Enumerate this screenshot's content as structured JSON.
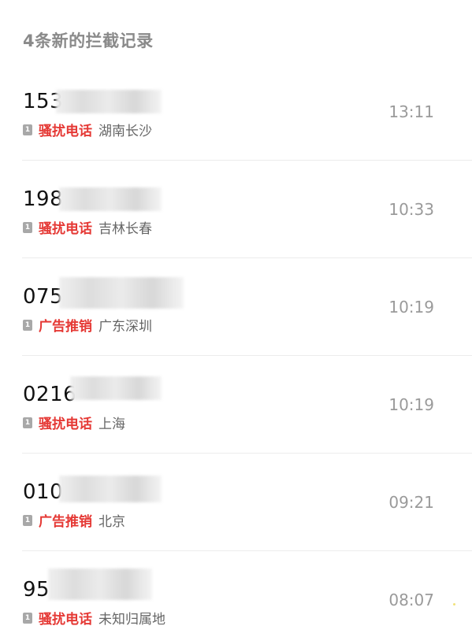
{
  "header": {
    "title": "4条新的拦截记录"
  },
  "records": [
    {
      "number": "153",
      "sim": "1",
      "tag": "骚扰电话",
      "location": "湖南长沙",
      "time": "13:11"
    },
    {
      "number": "198",
      "sim": "1",
      "tag": "骚扰电话",
      "location": "吉林长春",
      "time": "10:33"
    },
    {
      "number": "075",
      "sim": "1",
      "tag": "广告推销",
      "location": "广东深圳",
      "time": "10:19"
    },
    {
      "number": "0216",
      "sim": "1",
      "tag": "骚扰电话",
      "location": "上海",
      "time": "10:19"
    },
    {
      "number": "010",
      "sim": "1",
      "tag": "广告推销",
      "location": "北京",
      "time": "09:21"
    },
    {
      "number": "95",
      "sim": "1",
      "tag": "骚扰电话",
      "location": "未知归属地",
      "time": "08:07"
    }
  ]
}
